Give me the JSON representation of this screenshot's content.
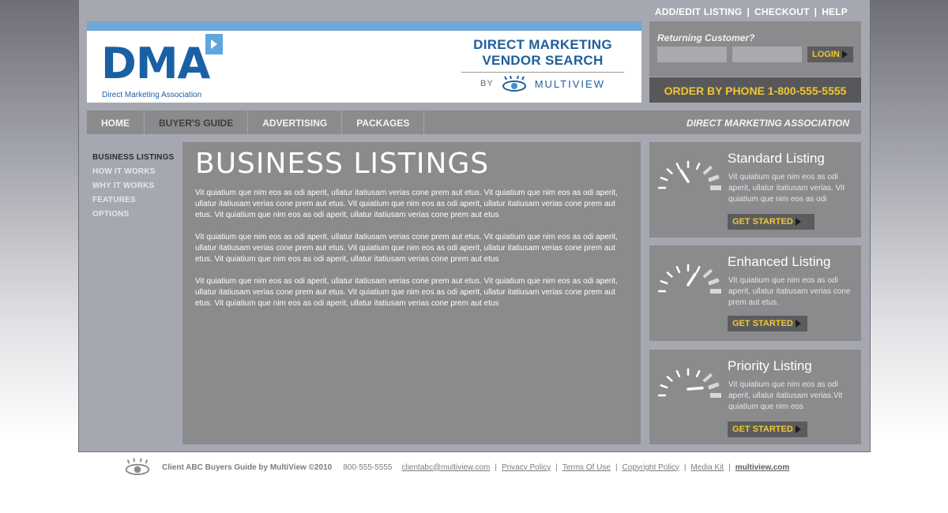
{
  "toplinks": {
    "add_edit": "ADD/EDIT LISTING",
    "checkout": "CHECKOUT",
    "help": "HELP",
    "sep": "|"
  },
  "header": {
    "logo_word": "DMA",
    "logo_tagline": "Direct Marketing Association",
    "vendor_title_line1": "DIRECT MARKETING",
    "vendor_title_line2": "VENDOR SEARCH",
    "by_label": "BY",
    "multiview": "MULTIVIEW"
  },
  "login": {
    "label": "Returning Customer?",
    "username_value": "",
    "password_value": "",
    "button": "LOGIN"
  },
  "phone_banner": "ORDER BY PHONE 1-800-555-5555",
  "nav": {
    "items": [
      "HOME",
      "BUYER'S GUIDE",
      "ADVERTISING",
      "PACKAGES"
    ],
    "right_label": "DIRECT MARKETING ASSOCIATION"
  },
  "sidemenu": {
    "items": [
      "BUSINESS LISTINGS",
      "HOW IT WORKS",
      "WHY IT WORKS",
      "FEATURES",
      "OPTIONS"
    ]
  },
  "main": {
    "title": "BUSINESS LISTINGS",
    "paragraphs": [
      "Vit quiatium que nim eos as odi aperit, ullatur itatiusam verias cone prem aut etus. Vit quiatium que nim eos as odi aperit, ullatur itatiusam verias cone prem aut etus. Vit quiatium que nim eos as odi aperit, ullatur itatiusam verias cone prem aut etus. Vit quiatium que nim eos as odi aperit, ullatur itatiusam verias cone prem aut etus",
      "Vit quiatium que nim eos as odi aperit, ullatur itatiusam verias cone prem aut etus. Vit quiatium que nim eos as odi aperit, ullatur itatiusam verias cone prem aut etus. Vit quiatium que nim eos as odi aperit, ullatur itatiusam verias cone prem aut etus. Vit quiatium que nim eos as odi aperit, ullatur itatiusam verias cone prem aut etus",
      "Vit quiatium que nim eos as odi aperit, ullatur itatiusam verias cone prem aut etus. Vit quiatium que nim eos as odi aperit, ullatur itatiusam verias cone prem aut etus. Vit quiatium que nim eos as odi aperit, ullatur itatiusam verias cone prem aut etus. Vit quiatium que nim eos as odi aperit, ullatur itatiusam verias cone prem aut etus"
    ]
  },
  "listings": [
    {
      "title": "Standard Listing",
      "desc": "Vit quiatium que nim eos as odi aperit, ullatur itatiusam verias. Vit quiatium que nim eos as odi",
      "button": "GET STARTED",
      "gauge_level": "low"
    },
    {
      "title": "Enhanced Listing",
      "desc": "Vit quiatium que nim eos as odi aperit, ullatur itatiusam verias cone prem aut etus.",
      "button": "GET STARTED",
      "gauge_level": "mid"
    },
    {
      "title": "Priority Listing",
      "desc": "Vit quiatium que nim eos as odi aperit, ullatur itatiusam verias.Vit quiatium que nim eos",
      "button": "GET STARTED",
      "gauge_level": "high"
    }
  ],
  "footer": {
    "credit": "Client ABC Buyers Guide by MultiView ©2010",
    "phone": "800-555-5555",
    "email": "clientabc@multiview.com",
    "privacy": "Privacy Policy",
    "terms": "Terms Of Use",
    "copyright": "Copyright Policy",
    "mediakit": "Media Kit",
    "site": "multiview.com",
    "sep": "|"
  },
  "colors": {
    "accent_blue": "#6fa7d8",
    "brand_blue": "#1a60a4",
    "cta_yellow": "#f0c72f",
    "panel_gray": "#8b8b8e"
  }
}
